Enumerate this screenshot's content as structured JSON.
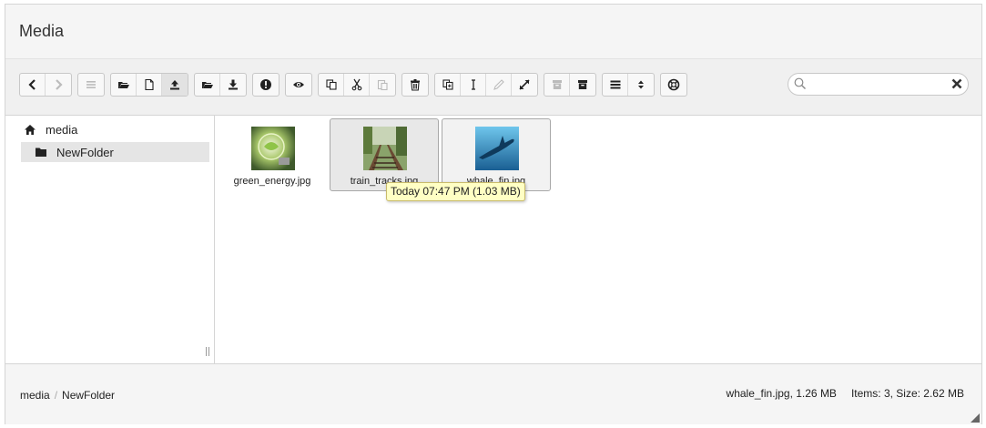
{
  "header": {
    "title": "Media"
  },
  "search": {
    "value": "",
    "placeholder": ""
  },
  "tree": {
    "root_label": "media",
    "children": [
      {
        "label": "NewFolder",
        "selected": true
      }
    ]
  },
  "files": [
    {
      "name": "green_energy.jpg",
      "state": "normal"
    },
    {
      "name": "train_tracks.jpg",
      "state": "hover"
    },
    {
      "name": "whale_fin.jpg",
      "state": "selected"
    }
  ],
  "tooltip": {
    "text": "Today 07:47 PM (1.03 MB)"
  },
  "breadcrumb": {
    "items": [
      "media",
      "NewFolder"
    ],
    "separator": "/"
  },
  "status": {
    "selected_info": "whale_fin.jpg, 1.26 MB",
    "totals": "Items: 3, Size: 2.62 MB"
  },
  "colors": {
    "hover_bg": "#e8e8e8",
    "tooltip_bg": "#ffffc4",
    "toolbar_bg": "#f0f0f0"
  }
}
